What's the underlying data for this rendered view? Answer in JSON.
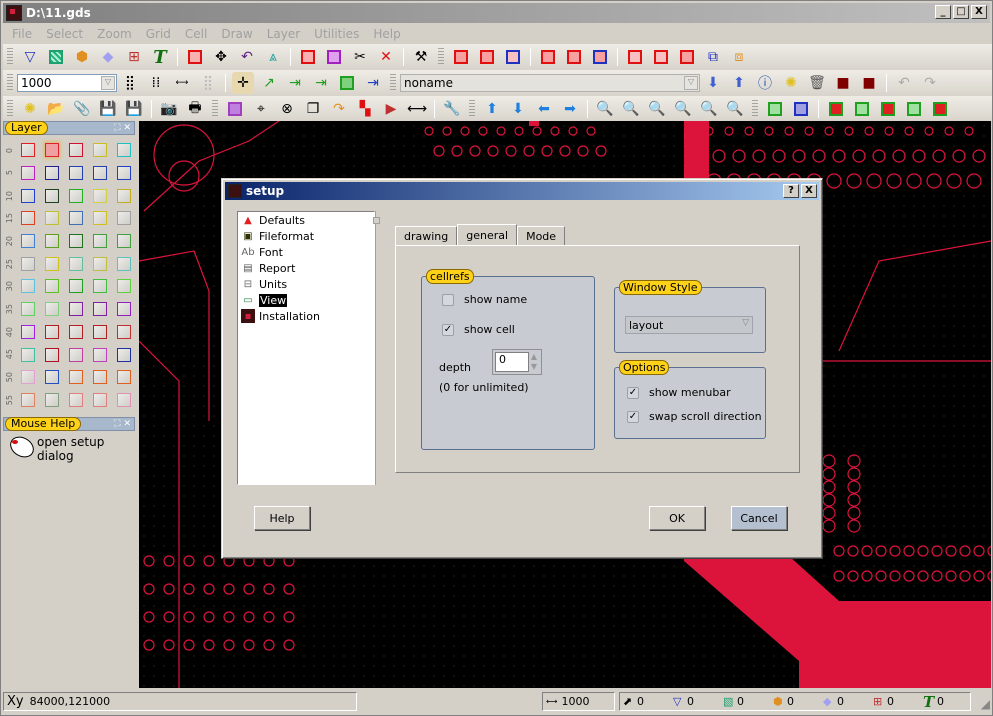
{
  "window": {
    "title": "D:\\11.gds",
    "minimize": "_",
    "maximize": "□",
    "close": "X"
  },
  "menu": [
    "File",
    "Select",
    "Zoom",
    "Grid",
    "Cell",
    "Draw",
    "Layer",
    "Utilities",
    "Help"
  ],
  "toolbar": {
    "grid_value": "1000",
    "cell_name": "noname"
  },
  "layer_panel": {
    "title": "Layer",
    "rows": [
      {
        "num": "0",
        "colors": [
          "#e02020",
          "#e02030",
          "#d01030",
          "#c8c020",
          "#20c0c0"
        ]
      },
      {
        "num": "5",
        "colors": [
          "#c020c0",
          "#202090",
          "#2040b0",
          "#2040b0",
          "#2040c0"
        ]
      },
      {
        "num": "10",
        "colors": [
          "#2040d0",
          "#204020",
          "#20b020",
          "#d0d040",
          "#c0b020"
        ]
      },
      {
        "num": "15",
        "colors": [
          "#e04020",
          "#c0c030",
          "#4070b0",
          "#d0c020",
          "#a0a0a0"
        ]
      },
      {
        "num": "20",
        "colors": [
          "#4080d0",
          "#60a020",
          "#207020",
          "#40a040",
          "#40a040"
        ]
      },
      {
        "num": "25",
        "colors": [
          "#a0a0a0",
          "#d0c020",
          "#60c0a0",
          "#c0c040",
          "#60c0c0"
        ]
      },
      {
        "num": "30",
        "colors": [
          "#60c0e0",
          "#60c020",
          "#20a020",
          "#40c040",
          "#60d040"
        ]
      },
      {
        "num": "35",
        "colors": [
          "#60d060",
          "#80d080",
          "#8020a0",
          "#8020a0",
          "#9020c0"
        ]
      },
      {
        "num": "40",
        "colors": [
          "#a020e0",
          "#b02020",
          "#b02020",
          "#b02020",
          "#c03030"
        ]
      },
      {
        "num": "45",
        "colors": [
          "#40c0a0",
          "#b01020",
          "#c040a0",
          "#c040c0",
          "#2030a0"
        ]
      },
      {
        "num": "50",
        "colors": [
          "#e0a0d0",
          "#2050c0",
          "#e06020",
          "#e06020",
          "#e06020"
        ]
      },
      {
        "num": "55",
        "colors": [
          "#e08060",
          "#80a080",
          "#e08080",
          "#e08080",
          "#e090b0"
        ]
      }
    ]
  },
  "mouse_help": {
    "title": "Mouse Help",
    "text_line1": "open setup",
    "text_line2": "dialog"
  },
  "status": {
    "coord_label": "Xy",
    "coords": "84000,121000",
    "grid_value": "1000",
    "counts": [
      {
        "icon": "cursor-icon",
        "value": "0"
      },
      {
        "icon": "path-icon",
        "value": "0"
      },
      {
        "icon": "box-icon",
        "value": "0"
      },
      {
        "icon": "polygon-icon",
        "value": "0"
      },
      {
        "icon": "cellref-icon",
        "value": "0"
      },
      {
        "icon": "cellref-array-icon",
        "value": "0"
      },
      {
        "icon": "text-icon",
        "value": "0"
      }
    ]
  },
  "dialog": {
    "title": "setup",
    "help_btn": "?",
    "close_btn": "X",
    "tree": [
      "Defaults",
      "Fileformat",
      "Font",
      "Report",
      "Units",
      "View",
      "Installation"
    ],
    "selected": "View",
    "tabs": [
      "drawing",
      "general",
      "Mode"
    ],
    "active_tab": "general",
    "cellrefs": {
      "label": "cellrefs",
      "show_name": {
        "label": "show name",
        "checked": false
      },
      "show_cell": {
        "label": "show cell",
        "checked": true
      },
      "depth_label": "depth",
      "depth_value": "0",
      "depth_hint": "(0 for unlimited)"
    },
    "window_style": {
      "label": "Window Style",
      "value": "layout"
    },
    "options": {
      "label": "Options",
      "show_menubar": {
        "label": "show menubar",
        "checked": true
      },
      "swap_scroll": {
        "label": "swap scroll direction",
        "checked": true
      }
    },
    "buttons": {
      "help": "Help",
      "ok": "OK",
      "cancel": "Cancel"
    }
  },
  "colors": {
    "accent": "#ffd21a",
    "trace": "#dc143c",
    "canvas": "#000000"
  }
}
